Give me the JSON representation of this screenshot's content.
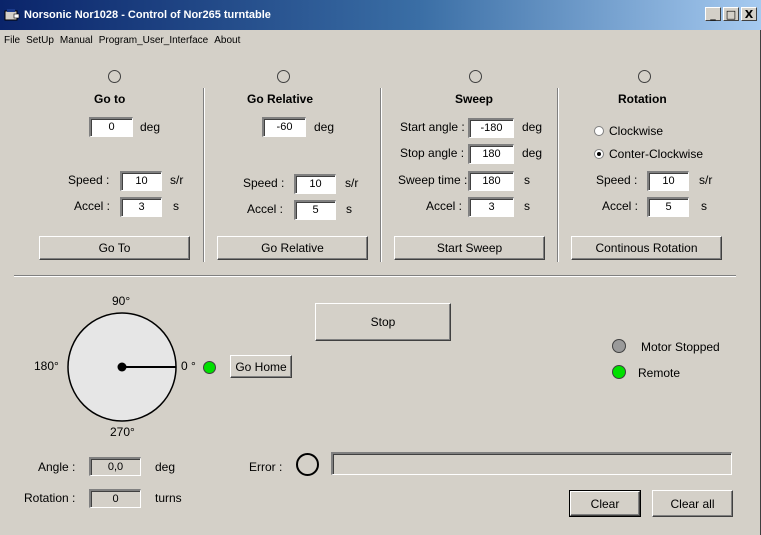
{
  "window": {
    "title": "Norsonic Nor1028 - Control of Nor265 turntable"
  },
  "titlebar_buttons": {
    "minimize": "_",
    "maximize": "□",
    "close": "X"
  },
  "menu": [
    "File",
    "SetUp",
    "Manual",
    "Program_User_Interface",
    "About"
  ],
  "goto": {
    "title": "Go to",
    "value": "0",
    "unit": "deg",
    "speed_label": "Speed :",
    "speed_value": "10",
    "speed_unit": "s/r",
    "accel_label": "Accel :",
    "accel_value": "3",
    "accel_unit": "s",
    "button": "Go To"
  },
  "gorelative": {
    "title": "Go Relative",
    "value": "-60",
    "unit": "deg",
    "speed_label": "Speed :",
    "speed_value": "10",
    "speed_unit": "s/r",
    "accel_label": "Accel :",
    "accel_value": "5",
    "accel_unit": "s",
    "button": "Go Relative"
  },
  "sweep": {
    "title": "Sweep",
    "start_label": "Start angle :",
    "start_value": "-180",
    "start_unit": "deg",
    "stop_label": "Stop angle :",
    "stop_value": "180",
    "stop_unit": "deg",
    "time_label": "Sweep time :",
    "time_value": "180",
    "time_unit": "s",
    "accel_label": "Accel :",
    "accel_value": "3",
    "accel_unit": "s",
    "button": "Start Sweep"
  },
  "rotation": {
    "title": "Rotation",
    "cw_label": "Clockwise",
    "ccw_label": "Conter-Clockwise",
    "selected": "Conter-Clockwise",
    "speed_label": "Speed :",
    "speed_value": "10",
    "speed_unit": "s/r",
    "accel_label": "Accel :",
    "accel_value": "5",
    "accel_unit": "s",
    "button": "Continous Rotation"
  },
  "dial": {
    "label_90": "90°",
    "label_180": "180°",
    "label_0": "0 °",
    "label_270": "270°",
    "pointer_angle_deg": 0
  },
  "go_home_button": "Go Home",
  "stop_button": "Stop",
  "status": {
    "motor_label": "Motor Stopped",
    "motor_color": "#9a9a9a",
    "remote_label": "Remote",
    "remote_color": "#00e000"
  },
  "home_led_color": "#00e000",
  "readout": {
    "angle_label": "Angle :",
    "angle_value": "0,0",
    "angle_unit": "deg",
    "rotation_label": "Rotation :",
    "rotation_value": "0",
    "rotation_unit": "turns"
  },
  "error": {
    "label": "Error :",
    "message": ""
  },
  "clear_button": "Clear",
  "clear_all_button": "Clear all"
}
